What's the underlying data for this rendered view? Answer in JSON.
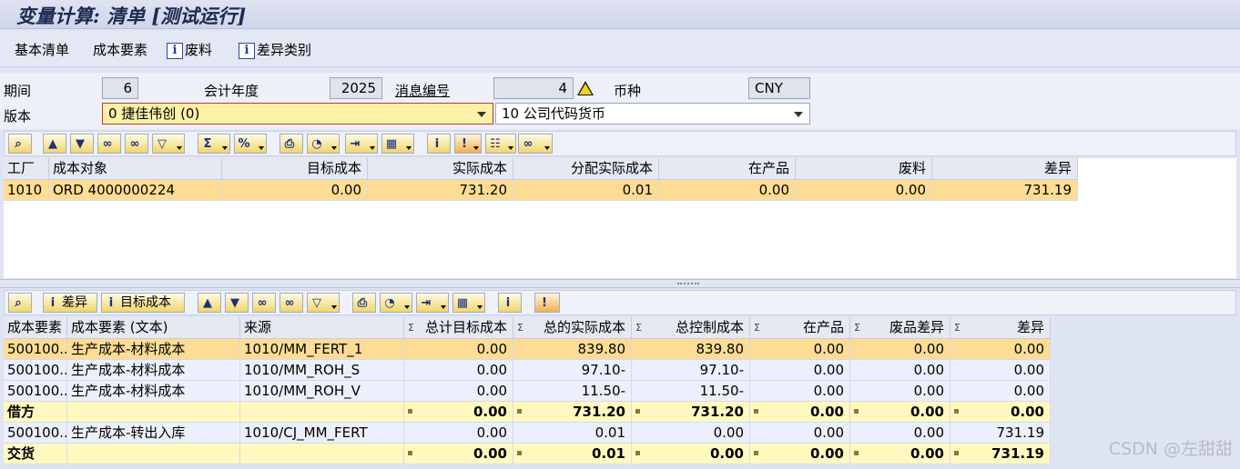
{
  "title": "变量计算: 清单 [测试运行]",
  "menu": {
    "basic_list": "基本清单",
    "cost_elements": "成本要素",
    "scrap": "废料",
    "variance_categories": "差异类别"
  },
  "form": {
    "period_label": "期间",
    "period_value": "6",
    "fiscal_year_label": "会计年度",
    "fiscal_year_value": "2025",
    "message_no_label": "消息编号",
    "message_no_value": "4",
    "currency_label": "币种",
    "currency_value": "CNY",
    "version_label": "版本",
    "version_value": "0 捷佳伟创 (0)",
    "currency_type_value": "10 公司代码货币"
  },
  "icons": {
    "info": "i",
    "warning": "warning-triangle-icon"
  },
  "upper_table": {
    "headers": [
      "工厂",
      "成本对象",
      "目标成本",
      "实际成本",
      "分配实际成本",
      "在产品",
      "废料",
      "差异"
    ],
    "rows": [
      [
        "1010",
        "ORD 4000000224",
        "0.00",
        "731.20",
        "0.01",
        "0.00",
        "0.00",
        "731.19"
      ]
    ]
  },
  "lower_toolbar": {
    "variance_btn": "差异",
    "target_cost_btn": "目标成本"
  },
  "lower_table": {
    "headers": [
      "成本要素",
      "成本要素 (文本)",
      "来源",
      "总计目标成本",
      "总的实际成本",
      "总控制成本",
      "在产品",
      "废品差异",
      "差异"
    ],
    "rows": [
      {
        "kind": "sel",
        "cells": [
          "500100...",
          "生产成本-材料成本",
          "1010/MM_FERT_1",
          "0.00",
          "839.80",
          "839.80",
          "0.00",
          "0.00",
          "0.00"
        ]
      },
      {
        "kind": "norm",
        "cells": [
          "500100...",
          "生产成本-材料成本",
          "1010/MM_ROH_S",
          "0.00",
          "97.10-",
          "97.10-",
          "0.00",
          "0.00",
          "0.00"
        ]
      },
      {
        "kind": "norm",
        "cells": [
          "500100...",
          "生产成本-材料成本",
          "1010/MM_ROH_V",
          "0.00",
          "11.50-",
          "11.50-",
          "0.00",
          "0.00",
          "0.00"
        ]
      },
      {
        "kind": "sum",
        "cells": [
          "借方",
          "",
          "",
          "0.00",
          "731.20",
          "731.20",
          "0.00",
          "0.00",
          "0.00"
        ]
      },
      {
        "kind": "norm",
        "cells": [
          "500100...",
          "生产成本-转出入库",
          "1010/CJ_MM_FERT",
          "0.00",
          "0.01",
          "0.00",
          "0.00",
          "0.00",
          "731.19"
        ]
      },
      {
        "kind": "sum",
        "cells": [
          "交货",
          "",
          "",
          "0.00",
          "0.01",
          "0.00",
          "0.00",
          "0.00",
          "731.19"
        ]
      }
    ]
  },
  "watermark": "CSDN @左甜甜",
  "colors": {
    "selected_row": "#ffdc93",
    "sum_row": "#fff9c0",
    "header": "#e6e9f2"
  }
}
